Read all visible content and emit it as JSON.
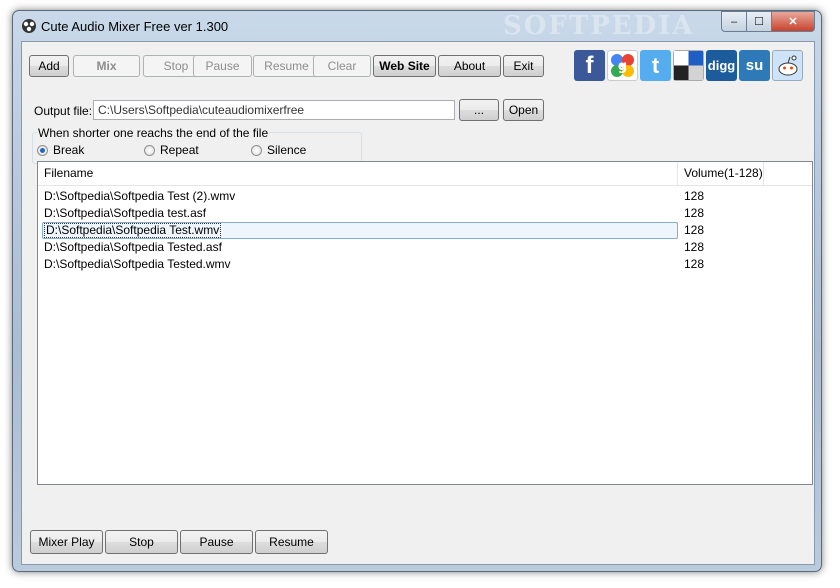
{
  "window": {
    "title": "Cute Audio Mixer Free ver 1.300",
    "watermark": "SOFTPEDIA",
    "controls": {
      "minimize": "‒",
      "maximize": "☐",
      "close": "✕"
    }
  },
  "toolbar": {
    "add": "Add",
    "mix": "Mix",
    "stop": "Stop",
    "pause": "Pause",
    "resume": "Resume",
    "clear": "Clear",
    "website": "Web Site",
    "about": "About",
    "exit": "Exit"
  },
  "social": [
    {
      "name": "facebook-icon",
      "glyph": "f",
      "color": "#3b5998"
    },
    {
      "name": "google-icon",
      "glyph": "g",
      "color": "#ffffff"
    },
    {
      "name": "twitter-icon",
      "glyph": "t",
      "color": "#55acee"
    },
    {
      "name": "delicious-icon",
      "glyph": "",
      "color": "#ffffff"
    },
    {
      "name": "digg-icon",
      "glyph": "digg",
      "color": "#1d5c9c"
    },
    {
      "name": "stumbleupon-icon",
      "glyph": "su",
      "color": "#2e79b8"
    },
    {
      "name": "reddit-icon",
      "glyph": "",
      "color": "#cee3f8"
    }
  ],
  "output": {
    "label": "Output file:",
    "value": "C:\\Users\\Softpedia\\cuteaudiomixerfree",
    "browse": "...",
    "open": "Open"
  },
  "shorter": {
    "label": "When shorter one reachs the end of the file",
    "options": [
      "Break",
      "Repeat",
      "Silence"
    ],
    "selected": "Break"
  },
  "list": {
    "columns": [
      "Filename",
      "Volume(1-128)"
    ],
    "rows": [
      {
        "file": "D:\\Softpedia\\Softpedia Test (2).wmv",
        "volume": "128"
      },
      {
        "file": "D:\\Softpedia\\Softpedia test.asf",
        "volume": "128"
      },
      {
        "file": "D:\\Softpedia\\Softpedia Test.wmv",
        "volume": "128"
      },
      {
        "file": "D:\\Softpedia\\Softpedia Tested.asf",
        "volume": "128"
      },
      {
        "file": "D:\\Softpedia\\Softpedia Tested.wmv",
        "volume": "128"
      }
    ],
    "selected_index": 2
  },
  "bottom": {
    "mixer_play": "Mixer Play",
    "stop": "Stop",
    "pause": "Pause",
    "resume": "Resume"
  }
}
